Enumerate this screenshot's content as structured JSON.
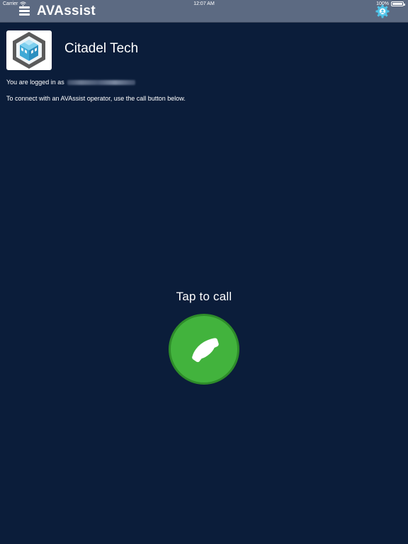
{
  "status_bar": {
    "carrier": "Carrier",
    "time": "12:07 AM",
    "battery": "100%"
  },
  "nav": {
    "title": "AVAssist",
    "menu_icon": "hamburger-menu-icon",
    "settings_icon": "gear-settings-icon"
  },
  "company": {
    "name": "Citadel Tech",
    "logo_icon": "citadel-cube-logo"
  },
  "session": {
    "logged_in_prefix": "You are logged in as",
    "connect_text": "To connect with an AVAssist operator, use the call button below."
  },
  "call": {
    "prompt": "Tap to call",
    "button_icon": "phone-icon"
  },
  "colors": {
    "background": "#0b1d3a",
    "navbar": "#5c6a82",
    "call_green": "#42b33d",
    "call_border": "#2e8c2a",
    "logo_teal": "#3fa9d6"
  }
}
